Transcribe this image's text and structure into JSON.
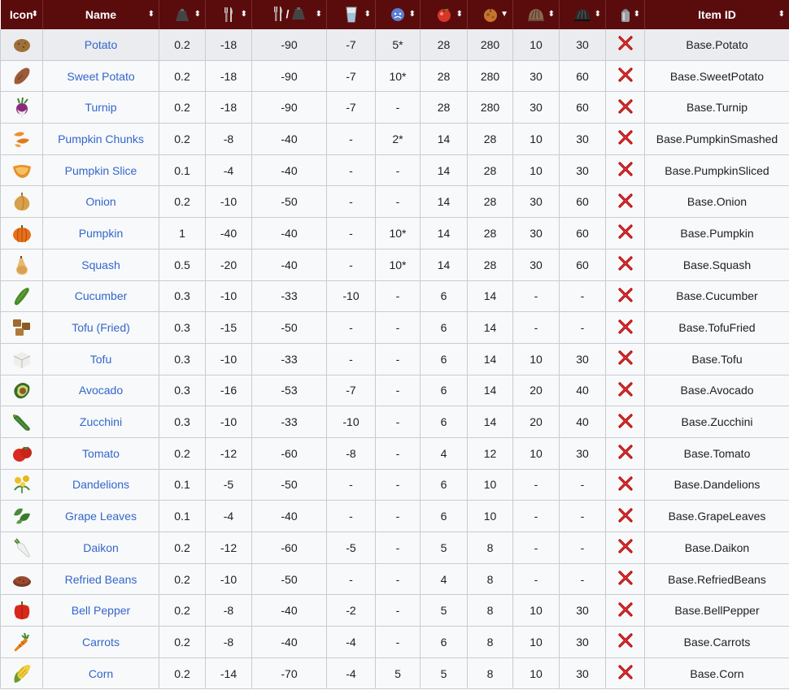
{
  "headers": {
    "icon": "Icon",
    "name": "Name",
    "per_weight_slash": "/",
    "item_id": "Item ID"
  },
  "header_icons": [
    "weight-icon",
    "fork-knife-icon",
    "fork-knife-per-weight-icon",
    "thirst-glass-icon",
    "unhappiness-face-icon",
    "fresh-apple-icon",
    "stale-apple-icon",
    "rotten-food-icon",
    "very-rotten-food-icon",
    "salt-shaker-icon"
  ],
  "colors": {
    "header_bg": "#5a0c0c",
    "link": "#3366cc",
    "x_mark": "#b00000"
  },
  "rows": [
    {
      "icon": "potato-icon",
      "name": "Potato",
      "weight": "0.2",
      "hunger": "-18",
      "hunger_per_weight": "-90",
      "thirst": "-7",
      "unhappiness": "5*",
      "fresh": "28",
      "rotten": "280",
      "cook_min": "10",
      "burn": "30",
      "id": "Base.Potato"
    },
    {
      "icon": "sweet-potato-icon",
      "name": "Sweet Potato",
      "weight": "0.2",
      "hunger": "-18",
      "hunger_per_weight": "-90",
      "thirst": "-7",
      "unhappiness": "10*",
      "fresh": "28",
      "rotten": "280",
      "cook_min": "30",
      "burn": "60",
      "id": "Base.SweetPotato"
    },
    {
      "icon": "turnip-icon",
      "name": "Turnip",
      "weight": "0.2",
      "hunger": "-18",
      "hunger_per_weight": "-90",
      "thirst": "-7",
      "unhappiness": "-",
      "fresh": "28",
      "rotten": "280",
      "cook_min": "30",
      "burn": "60",
      "id": "Base.Turnip"
    },
    {
      "icon": "pumpkin-chunks-icon",
      "name": "Pumpkin Chunks",
      "weight": "0.2",
      "hunger": "-8",
      "hunger_per_weight": "-40",
      "thirst": "-",
      "unhappiness": "2*",
      "fresh": "14",
      "rotten": "28",
      "cook_min": "10",
      "burn": "30",
      "id": "Base.PumpkinSmashed"
    },
    {
      "icon": "pumpkin-slice-icon",
      "name": "Pumpkin Slice",
      "weight": "0.1",
      "hunger": "-4",
      "hunger_per_weight": "-40",
      "thirst": "-",
      "unhappiness": "-",
      "fresh": "14",
      "rotten": "28",
      "cook_min": "10",
      "burn": "30",
      "id": "Base.PumpkinSliced"
    },
    {
      "icon": "onion-icon",
      "name": "Onion",
      "weight": "0.2",
      "hunger": "-10",
      "hunger_per_weight": "-50",
      "thirst": "-",
      "unhappiness": "-",
      "fresh": "14",
      "rotten": "28",
      "cook_min": "30",
      "burn": "60",
      "id": "Base.Onion"
    },
    {
      "icon": "pumpkin-icon",
      "name": "Pumpkin",
      "weight": "1",
      "hunger": "-40",
      "hunger_per_weight": "-40",
      "thirst": "-",
      "unhappiness": "10*",
      "fresh": "14",
      "rotten": "28",
      "cook_min": "30",
      "burn": "60",
      "id": "Base.Pumpkin"
    },
    {
      "icon": "squash-icon",
      "name": "Squash",
      "weight": "0.5",
      "hunger": "-20",
      "hunger_per_weight": "-40",
      "thirst": "-",
      "unhappiness": "10*",
      "fresh": "14",
      "rotten": "28",
      "cook_min": "30",
      "burn": "60",
      "id": "Base.Squash"
    },
    {
      "icon": "cucumber-icon",
      "name": "Cucumber",
      "weight": "0.3",
      "hunger": "-10",
      "hunger_per_weight": "-33",
      "thirst": "-10",
      "unhappiness": "-",
      "fresh": "6",
      "rotten": "14",
      "cook_min": "-",
      "burn": "-",
      "id": "Base.Cucumber"
    },
    {
      "icon": "tofu-fried-icon",
      "name": "Tofu (Fried)",
      "weight": "0.3",
      "hunger": "-15",
      "hunger_per_weight": "-50",
      "thirst": "-",
      "unhappiness": "-",
      "fresh": "6",
      "rotten": "14",
      "cook_min": "-",
      "burn": "-",
      "id": "Base.TofuFried"
    },
    {
      "icon": "tofu-icon",
      "name": "Tofu",
      "weight": "0.3",
      "hunger": "-10",
      "hunger_per_weight": "-33",
      "thirst": "-",
      "unhappiness": "-",
      "fresh": "6",
      "rotten": "14",
      "cook_min": "10",
      "burn": "30",
      "id": "Base.Tofu"
    },
    {
      "icon": "avocado-icon",
      "name": "Avocado",
      "weight": "0.3",
      "hunger": "-16",
      "hunger_per_weight": "-53",
      "thirst": "-7",
      "unhappiness": "-",
      "fresh": "6",
      "rotten": "14",
      "cook_min": "20",
      "burn": "40",
      "id": "Base.Avocado"
    },
    {
      "icon": "zucchini-icon",
      "name": "Zucchini",
      "weight": "0.3",
      "hunger": "-10",
      "hunger_per_weight": "-33",
      "thirst": "-10",
      "unhappiness": "-",
      "fresh": "6",
      "rotten": "14",
      "cook_min": "20",
      "burn": "40",
      "id": "Base.Zucchini"
    },
    {
      "icon": "tomato-icon",
      "name": "Tomato",
      "weight": "0.2",
      "hunger": "-12",
      "hunger_per_weight": "-60",
      "thirst": "-8",
      "unhappiness": "-",
      "fresh": "4",
      "rotten": "12",
      "cook_min": "10",
      "burn": "30",
      "id": "Base.Tomato"
    },
    {
      "icon": "dandelions-icon",
      "name": "Dandelions",
      "weight": "0.1",
      "hunger": "-5",
      "hunger_per_weight": "-50",
      "thirst": "-",
      "unhappiness": "-",
      "fresh": "6",
      "rotten": "10",
      "cook_min": "-",
      "burn": "-",
      "id": "Base.Dandelions"
    },
    {
      "icon": "grape-leaves-icon",
      "name": "Grape Leaves",
      "weight": "0.1",
      "hunger": "-4",
      "hunger_per_weight": "-40",
      "thirst": "-",
      "unhappiness": "-",
      "fresh": "6",
      "rotten": "10",
      "cook_min": "-",
      "burn": "-",
      "id": "Base.GrapeLeaves"
    },
    {
      "icon": "daikon-icon",
      "name": "Daikon",
      "weight": "0.2",
      "hunger": "-12",
      "hunger_per_weight": "-60",
      "thirst": "-5",
      "unhappiness": "-",
      "fresh": "5",
      "rotten": "8",
      "cook_min": "-",
      "burn": "-",
      "id": "Base.Daikon"
    },
    {
      "icon": "refried-beans-icon",
      "name": "Refried Beans",
      "weight": "0.2",
      "hunger": "-10",
      "hunger_per_weight": "-50",
      "thirst": "-",
      "unhappiness": "-",
      "fresh": "4",
      "rotten": "8",
      "cook_min": "-",
      "burn": "-",
      "id": "Base.RefriedBeans"
    },
    {
      "icon": "bell-pepper-icon",
      "name": "Bell Pepper",
      "weight": "0.2",
      "hunger": "-8",
      "hunger_per_weight": "-40",
      "thirst": "-2",
      "unhappiness": "-",
      "fresh": "5",
      "rotten": "8",
      "cook_min": "10",
      "burn": "30",
      "id": "Base.BellPepper"
    },
    {
      "icon": "carrots-icon",
      "name": "Carrots",
      "weight": "0.2",
      "hunger": "-8",
      "hunger_per_weight": "-40",
      "thirst": "-4",
      "unhappiness": "-",
      "fresh": "6",
      "rotten": "8",
      "cook_min": "10",
      "burn": "30",
      "id": "Base.Carrots"
    },
    {
      "icon": "corn-icon",
      "name": "Corn",
      "weight": "0.2",
      "hunger": "-14",
      "hunger_per_weight": "-70",
      "thirst": "-4",
      "unhappiness": "5",
      "fresh": "5",
      "rotten": "8",
      "cook_min": "10",
      "burn": "30",
      "id": "Base.Corn"
    }
  ]
}
